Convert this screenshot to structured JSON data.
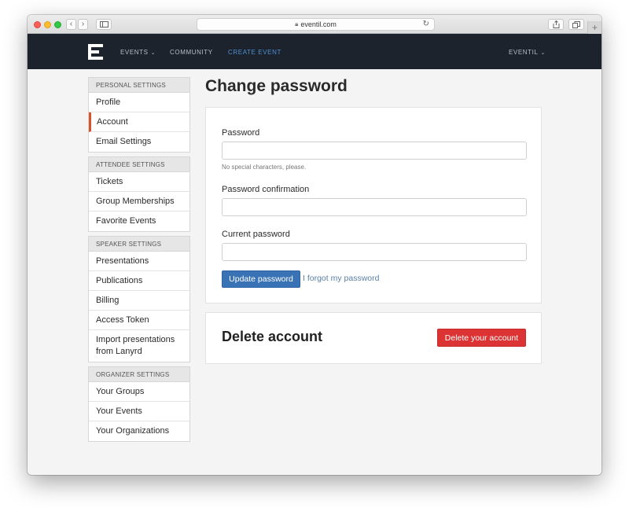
{
  "browser": {
    "url": "eventil.com"
  },
  "nav": {
    "items": [
      {
        "label": "EVENTS",
        "has_caret": true
      },
      {
        "label": "COMMUNITY",
        "has_caret": false
      },
      {
        "label": "CREATE EVENT",
        "has_caret": false
      }
    ],
    "user_menu": "EVENTIL",
    "active_color": "#4f8fd3",
    "background": "#1c232d"
  },
  "sidebar": {
    "groups": [
      {
        "heading": "PERSONAL SETTINGS",
        "items": [
          "Profile",
          "Account",
          "Email Settings"
        ]
      },
      {
        "heading": "ATTENDEE SETTINGS",
        "items": [
          "Tickets",
          "Group Memberships",
          "Favorite Events"
        ]
      },
      {
        "heading": "SPEAKER SETTINGS",
        "items": [
          "Presentations",
          "Publications",
          "Billing",
          "Access Token",
          "Import presentations from Lanyrd"
        ]
      },
      {
        "heading": "ORGANIZER SETTINGS",
        "items": [
          "Your Groups",
          "Your Events",
          "Your Organizations"
        ]
      }
    ],
    "selected": "Account",
    "selected_accent": "#d2552c"
  },
  "main": {
    "title": "Change password",
    "form": {
      "password_label": "Password",
      "password_value": "",
      "password_hint": "No special characters, please.",
      "confirmation_label": "Password confirmation",
      "confirmation_value": "",
      "current_label": "Current password",
      "current_value": "",
      "submit_label": "Update password",
      "forgot_label": "I forgot my password"
    },
    "delete": {
      "title": "Delete account",
      "button_label": "Delete your account",
      "button_color": "#dc3434"
    }
  }
}
